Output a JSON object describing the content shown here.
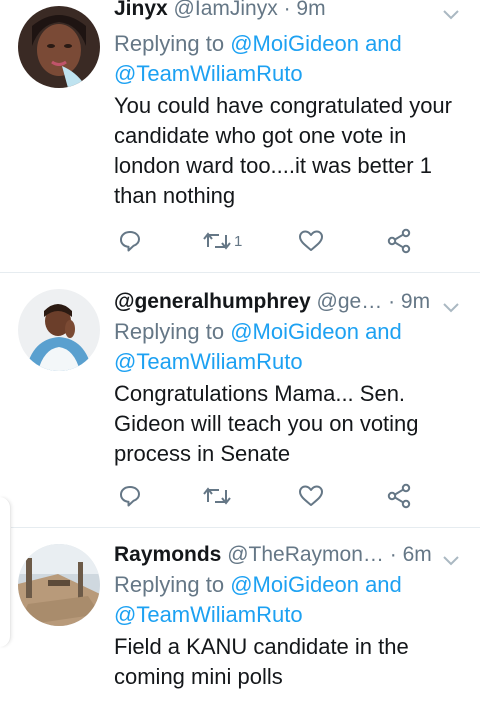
{
  "tweets": [
    {
      "name": "Jinyx",
      "handle": "@IamJinyx",
      "time": "9m",
      "replying_prefix": "Replying to",
      "mention1": "@MoiGideon",
      "and": "and",
      "mention2": "@TeamWiliamRuto",
      "text": "You could have congratulated your candidate who got one vote in london ward too....it was better 1 than nothing",
      "retweet_count": "1"
    },
    {
      "name": "@generalhumphrey",
      "handle": "@ge…",
      "time": "9m",
      "replying_prefix": "Replying to",
      "mention1": "@MoiGideon",
      "and": "and",
      "mention2": "@TeamWiliamRuto",
      "text": "Congratulations Mama... Sen. Gideon will teach you on voting process in Senate",
      "retweet_count": ""
    },
    {
      "name": "Raymonds",
      "handle": "@TheRaymon…",
      "time": "6m",
      "replying_prefix": "Replying to",
      "mention1": "@MoiGideon",
      "and": "and",
      "mention2": "@TeamWiliamRuto",
      "text": "Field a KANU candidate in the coming mini polls",
      "retweet_count": ""
    }
  ],
  "separator": "·",
  "icons": [
    "reply-icon",
    "retweet-icon",
    "like-icon",
    "share-icon",
    "chevron-down-icon"
  ],
  "colors": {
    "link": "#1da1f2",
    "secondary": "#657786",
    "text": "#14171a",
    "divider": "#e6ecf0"
  }
}
